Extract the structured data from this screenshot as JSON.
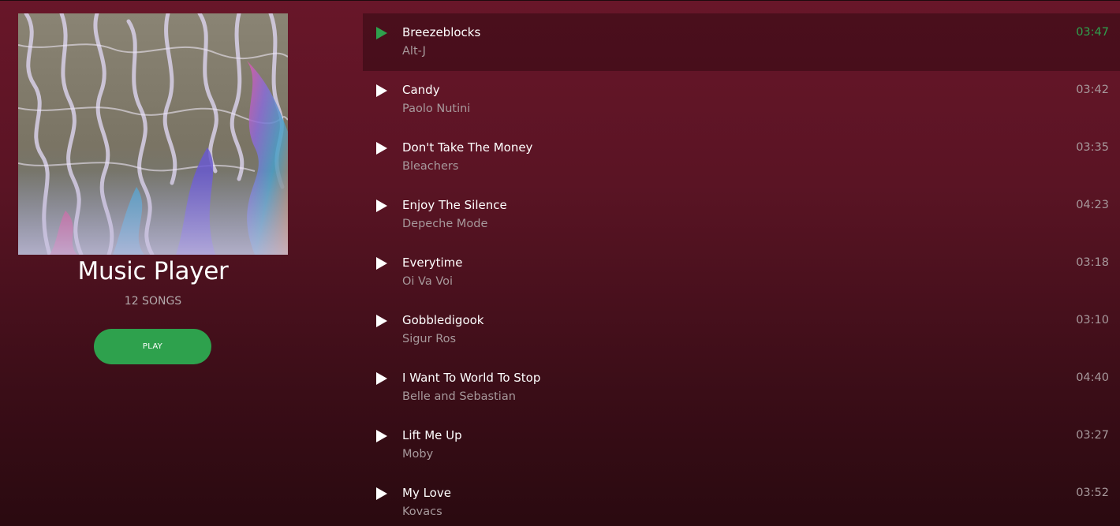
{
  "app": {
    "title": "Music Player",
    "song_count": "12 SONGS",
    "play_label": "PLAY"
  },
  "colors": {
    "accent": "#2ea14d",
    "background_top": "#681629",
    "background_bottom": "#2a0a10",
    "muted_text": "#a7999c"
  },
  "tracks": [
    {
      "name": "Breezeblocks",
      "artist": "Alt-J",
      "duration": "03:47",
      "active": true
    },
    {
      "name": "Candy",
      "artist": "Paolo Nutini",
      "duration": "03:42",
      "active": false
    },
    {
      "name": "Don't Take The Money",
      "artist": "Bleachers",
      "duration": "03:35",
      "active": false
    },
    {
      "name": "Enjoy The Silence",
      "artist": "Depeche Mode",
      "duration": "04:23",
      "active": false
    },
    {
      "name": "Everytime",
      "artist": "Oi Va Voi",
      "duration": "03:18",
      "active": false
    },
    {
      "name": "Gobbledigook",
      "artist": "Sigur Ros",
      "duration": "03:10",
      "active": false
    },
    {
      "name": "I Want To World To Stop",
      "artist": "Belle and Sebastian",
      "duration": "04:40",
      "active": false
    },
    {
      "name": "Lift Me Up",
      "artist": "Moby",
      "duration": "03:27",
      "active": false
    },
    {
      "name": "My Love",
      "artist": "Kovacs",
      "duration": "03:52",
      "active": false
    }
  ]
}
